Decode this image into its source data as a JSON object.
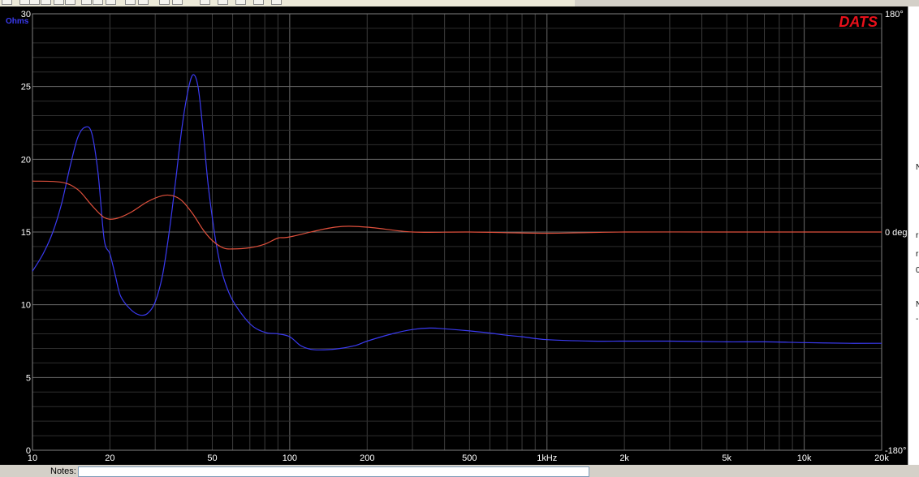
{
  "brand": {
    "logo_text": "DATS",
    "color": "#e8101a"
  },
  "notes": {
    "label": "Notes:",
    "value": ""
  },
  "right_panel": {
    "chars": [
      "N",
      "r",
      "r",
      "0",
      "N",
      "-"
    ]
  },
  "toolbar": {
    "button_count": 18
  },
  "chart_data": {
    "type": "line",
    "title": "",
    "x_scale": "log",
    "xlim": [
      10,
      20000
    ],
    "ylim": [
      0,
      30
    ],
    "y2lim": [
      -180,
      180
    ],
    "grid": true,
    "background": "#000000",
    "x_tick_labels": [
      {
        "v": 10,
        "t": "10"
      },
      {
        "v": 20,
        "t": "20"
      },
      {
        "v": 50,
        "t": "50"
      },
      {
        "v": 100,
        "t": "100"
      },
      {
        "v": 200,
        "t": "200"
      },
      {
        "v": 500,
        "t": "500"
      },
      {
        "v": 1000,
        "t": "1kHz"
      },
      {
        "v": 2000,
        "t": "2k"
      },
      {
        "v": 5000,
        "t": "5k"
      },
      {
        "v": 10000,
        "t": "10k"
      },
      {
        "v": 20000,
        "t": "20k"
      }
    ],
    "y_ticks": [
      0,
      5,
      10,
      15,
      20,
      25,
      30
    ],
    "y_label": "Ohms",
    "y2_ticks": [
      {
        "v": 180,
        "t": "180°"
      },
      {
        "v": 0,
        "t": "0 deg"
      },
      {
        "v": -180,
        "t": "-180°"
      }
    ],
    "series": [
      {
        "id": "impedance",
        "axis": "y",
        "color": "#3a3af0",
        "unit": "Ohms",
        "points": [
          [
            10,
            12.3
          ],
          [
            11,
            13.5
          ],
          [
            12,
            15.0
          ],
          [
            13,
            17.0
          ],
          [
            14,
            19.5
          ],
          [
            15,
            21.5
          ],
          [
            16,
            22.2
          ],
          [
            17,
            21.8
          ],
          [
            18,
            19.0
          ],
          [
            19,
            14.5
          ],
          [
            20,
            13.5
          ],
          [
            21,
            12.0
          ],
          [
            22,
            10.6
          ],
          [
            24,
            9.7
          ],
          [
            26,
            9.3
          ],
          [
            28,
            9.4
          ],
          [
            30,
            10.2
          ],
          [
            32,
            12.0
          ],
          [
            34,
            15.0
          ],
          [
            36,
            18.5
          ],
          [
            38,
            22.0
          ],
          [
            40,
            24.5
          ],
          [
            42,
            25.8
          ],
          [
            44,
            25.0
          ],
          [
            46,
            22.0
          ],
          [
            48,
            18.5
          ],
          [
            50,
            16.0
          ],
          [
            52,
            14.0
          ],
          [
            55,
            12.0
          ],
          [
            60,
            10.3
          ],
          [
            70,
            8.7
          ],
          [
            80,
            8.1
          ],
          [
            90,
            8.0
          ],
          [
            100,
            7.8
          ],
          [
            110,
            7.2
          ],
          [
            120,
            6.95
          ],
          [
            130,
            6.9
          ],
          [
            150,
            6.95
          ],
          [
            180,
            7.2
          ],
          [
            200,
            7.5
          ],
          [
            250,
            8.0
          ],
          [
            300,
            8.3
          ],
          [
            350,
            8.4
          ],
          [
            400,
            8.35
          ],
          [
            500,
            8.2
          ],
          [
            600,
            8.05
          ],
          [
            700,
            7.9
          ],
          [
            800,
            7.8
          ],
          [
            1000,
            7.6
          ],
          [
            1500,
            7.5
          ],
          [
            2000,
            7.5
          ],
          [
            3000,
            7.5
          ],
          [
            5000,
            7.45
          ],
          [
            7000,
            7.45
          ],
          [
            10000,
            7.4
          ],
          [
            15000,
            7.35
          ],
          [
            20000,
            7.35
          ]
        ]
      },
      {
        "id": "phase",
        "axis": "y2",
        "color": "#e0503c",
        "unit": "deg",
        "points": [
          [
            10,
            42
          ],
          [
            13,
            41
          ],
          [
            15,
            35
          ],
          [
            17,
            22
          ],
          [
            19,
            12
          ],
          [
            21,
            11
          ],
          [
            24,
            16
          ],
          [
            28,
            25
          ],
          [
            32,
            30
          ],
          [
            35,
            30
          ],
          [
            38,
            26
          ],
          [
            42,
            15
          ],
          [
            46,
            2
          ],
          [
            50,
            -7
          ],
          [
            55,
            -13
          ],
          [
            60,
            -14
          ],
          [
            70,
            -13
          ],
          [
            80,
            -10
          ],
          [
            90,
            -5
          ],
          [
            100,
            -4
          ],
          [
            150,
            4
          ],
          [
            200,
            4
          ],
          [
            300,
            0
          ],
          [
            500,
            0
          ],
          [
            1000,
            -1
          ],
          [
            2000,
            0
          ],
          [
            5000,
            0
          ],
          [
            10000,
            0
          ],
          [
            20000,
            0
          ]
        ]
      }
    ]
  }
}
